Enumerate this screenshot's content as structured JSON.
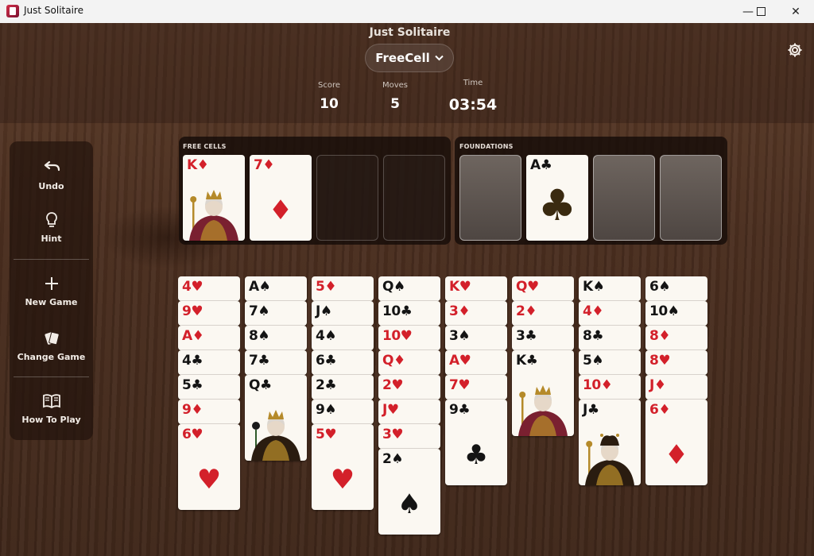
{
  "window": {
    "title": "Just Solitaire"
  },
  "header": {
    "app_name": "Just Solitaire",
    "mode": "FreeCell",
    "stats": {
      "score_label": "Score",
      "score": "10",
      "moves_label": "Moves",
      "moves": "5",
      "time_label": "Time",
      "time": "03:54"
    }
  },
  "sidebar": {
    "undo": "Undo",
    "hint": "Hint",
    "new_game": "New Game",
    "change_game": "Change Game",
    "how_to_play": "How To Play"
  },
  "free_cells": {
    "label": "FREE CELLS",
    "cards": [
      {
        "rank": "K",
        "suit": "♦",
        "color": "red",
        "face": "king"
      },
      {
        "rank": "7",
        "suit": "♦",
        "color": "red",
        "face": "pip"
      },
      null,
      null
    ]
  },
  "foundations": {
    "label": "FOUNDATIONS",
    "cards": [
      null,
      {
        "rank": "A",
        "suit": "♣",
        "color": "black",
        "face": "ace"
      },
      null,
      null
    ]
  },
  "tableau": [
    [
      {
        "rank": "4",
        "suit": "♥",
        "color": "red"
      },
      {
        "rank": "9",
        "suit": "♥",
        "color": "red"
      },
      {
        "rank": "A",
        "suit": "♦",
        "color": "red"
      },
      {
        "rank": "4",
        "suit": "♣",
        "color": "black"
      },
      {
        "rank": "5",
        "suit": "♣",
        "color": "black"
      },
      {
        "rank": "9",
        "suit": "♦",
        "color": "red"
      },
      {
        "rank": "6",
        "suit": "♥",
        "color": "red",
        "face": "pip"
      }
    ],
    [
      {
        "rank": "A",
        "suit": "♠",
        "color": "black"
      },
      {
        "rank": "7",
        "suit": "♠",
        "color": "black"
      },
      {
        "rank": "8",
        "suit": "♠",
        "color": "black"
      },
      {
        "rank": "7",
        "suit": "♣",
        "color": "black"
      },
      {
        "rank": "Q",
        "suit": "♣",
        "color": "black",
        "face": "queen"
      }
    ],
    [
      {
        "rank": "5",
        "suit": "♦",
        "color": "red"
      },
      {
        "rank": "J",
        "suit": "♠",
        "color": "black"
      },
      {
        "rank": "4",
        "suit": "♠",
        "color": "black"
      },
      {
        "rank": "6",
        "suit": "♣",
        "color": "black"
      },
      {
        "rank": "2",
        "suit": "♣",
        "color": "black"
      },
      {
        "rank": "9",
        "suit": "♠",
        "color": "black"
      },
      {
        "rank": "5",
        "suit": "♥",
        "color": "red",
        "face": "pip"
      }
    ],
    [
      {
        "rank": "Q",
        "suit": "♠",
        "color": "black"
      },
      {
        "rank": "10",
        "suit": "♣",
        "color": "black"
      },
      {
        "rank": "10",
        "suit": "♥",
        "color": "red"
      },
      {
        "rank": "Q",
        "suit": "♦",
        "color": "red"
      },
      {
        "rank": "2",
        "suit": "♥",
        "color": "red"
      },
      {
        "rank": "J",
        "suit": "♥",
        "color": "red"
      },
      {
        "rank": "3",
        "suit": "♥",
        "color": "red"
      },
      {
        "rank": "2",
        "suit": "♠",
        "color": "black",
        "face": "pip"
      }
    ],
    [
      {
        "rank": "K",
        "suit": "♥",
        "color": "red"
      },
      {
        "rank": "3",
        "suit": "♦",
        "color": "red"
      },
      {
        "rank": "3",
        "suit": "♠",
        "color": "black"
      },
      {
        "rank": "A",
        "suit": "♥",
        "color": "red"
      },
      {
        "rank": "7",
        "suit": "♥",
        "color": "red"
      },
      {
        "rank": "9",
        "suit": "♣",
        "color": "black",
        "face": "pip"
      }
    ],
    [
      {
        "rank": "Q",
        "suit": "♥",
        "color": "red"
      },
      {
        "rank": "2",
        "suit": "♦",
        "color": "red"
      },
      {
        "rank": "3",
        "suit": "♣",
        "color": "black"
      },
      {
        "rank": "K",
        "suit": "♣",
        "color": "black",
        "face": "king"
      }
    ],
    [
      {
        "rank": "K",
        "suit": "♠",
        "color": "black"
      },
      {
        "rank": "4",
        "suit": "♦",
        "color": "red"
      },
      {
        "rank": "8",
        "suit": "♣",
        "color": "black"
      },
      {
        "rank": "5",
        "suit": "♠",
        "color": "black"
      },
      {
        "rank": "10",
        "suit": "♦",
        "color": "red"
      },
      {
        "rank": "J",
        "suit": "♣",
        "color": "black",
        "face": "jack"
      }
    ],
    [
      {
        "rank": "6",
        "suit": "♠",
        "color": "black"
      },
      {
        "rank": "10",
        "suit": "♠",
        "color": "black"
      },
      {
        "rank": "8",
        "suit": "♦",
        "color": "red"
      },
      {
        "rank": "8",
        "suit": "♥",
        "color": "red"
      },
      {
        "rank": "J",
        "suit": "♦",
        "color": "red"
      },
      {
        "rank": "6",
        "suit": "♦",
        "color": "red",
        "face": "pip"
      }
    ]
  ],
  "colors": {
    "red_suit": "#d3202a",
    "black_suit": "#141414",
    "card_face": "#fbf8f2"
  },
  "icons": {
    "undo": "undo-icon",
    "hint": "lightbulb-icon",
    "new_game": "plus-icon",
    "change_game": "cards-icon",
    "how_to_play": "book-icon",
    "settings": "gear-icon"
  }
}
